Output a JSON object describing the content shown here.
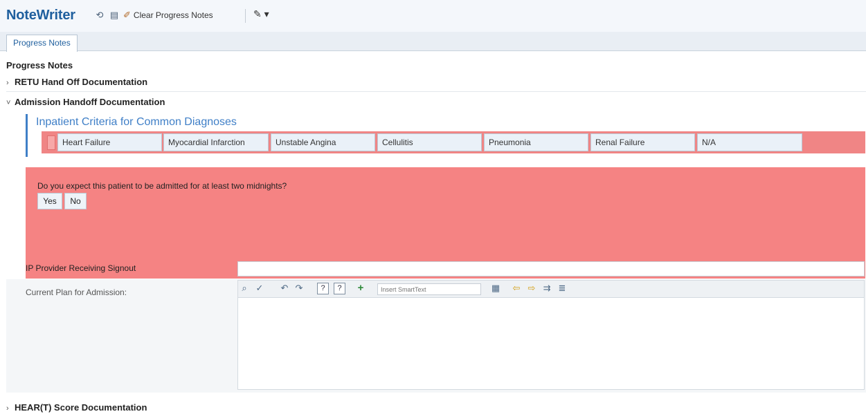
{
  "app": {
    "title": "NoteWriter"
  },
  "toolbar": {
    "clear_label": "Clear Progress Notes"
  },
  "tabs": [
    {
      "label": "Progress Notes"
    }
  ],
  "section_title": "Progress Notes",
  "groups": {
    "retu": "RETU Hand Off Documentation",
    "admission": "Admission Handoff Documentation",
    "heart": "HEAR(T) Score Documentation"
  },
  "criteria": {
    "title": "Inpatient Criteria for Common Diagnoses",
    "options": [
      "Heart Failure",
      "Myocardial Infarction",
      "Unstable Angina",
      "Cellulitis",
      "Pneumonia",
      "Renal Failure",
      "N/A"
    ]
  },
  "two_midnights": {
    "question": "Do you expect this patient to be admitted for at least two midnights?",
    "yes_label": "Yes",
    "no_label": "No"
  },
  "ip_provider": {
    "label": "IP Provider Receiving Signout",
    "value": ""
  },
  "plan": {
    "label": "Current Plan for Admission:",
    "smarttext_placeholder": "Insert SmartText",
    "value": ""
  },
  "colors": {
    "required_red": "#f58383",
    "accent_blue": "#3f7fc7",
    "title_blue": "#1f5f9e"
  }
}
